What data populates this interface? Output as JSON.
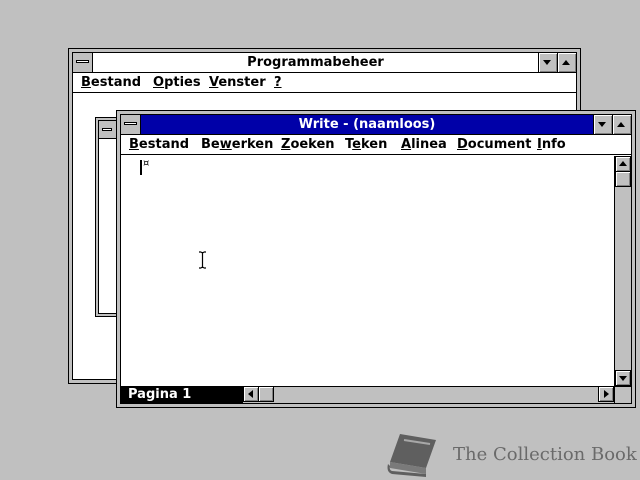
{
  "program_manager": {
    "title": "Programmabeheer",
    "menu": [
      {
        "pre": "",
        "key": "B",
        "post": "estand"
      },
      {
        "pre": "",
        "key": "O",
        "post": "pties"
      },
      {
        "pre": "",
        "key": "V",
        "post": "enster"
      },
      {
        "pre": "",
        "key": "?",
        "post": ""
      }
    ]
  },
  "write": {
    "title": "Write - (naamloos)",
    "menu": [
      {
        "pre": "",
        "key": "B",
        "post": "estand"
      },
      {
        "pre": "Be",
        "key": "w",
        "post": "erken"
      },
      {
        "pre": "",
        "key": "Z",
        "post": "oeken"
      },
      {
        "pre": "T",
        "key": "e",
        "post": "ken"
      },
      {
        "pre": "",
        "key": "A",
        "post": "linea"
      },
      {
        "pre": "",
        "key": "D",
        "post": "ocument"
      },
      {
        "pre": "",
        "key": "I",
        "post": "nfo"
      }
    ],
    "status": "Pagina 1",
    "end_mark": "¤"
  },
  "watermark": {
    "text": "The Collection Book",
    "icon": "book-icon"
  },
  "colors": {
    "desktop": "#c0c0c0",
    "active_title": "#0000a8",
    "window": "#ffffff"
  }
}
